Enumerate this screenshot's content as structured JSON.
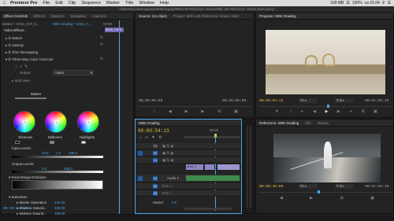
{
  "menubar": {
    "app": "Premiere Pro",
    "items": [
      "File",
      "Edit",
      "Clip",
      "Sequence",
      "Marker",
      "Title",
      "Window",
      "Help"
    ],
    "memory": "109 MB",
    "battery": "100%",
    "clock": "ca 15.04",
    "user": "Q"
  },
  "path": "~/Users/nicomsooyparus/Work/Aug.tip/M06.L05 Reference Viewer/M06 L05 Reference Viewer Start.prproj *",
  "effect_controls": {
    "tabs": [
      "Effect Controls",
      "Effects",
      "Markers",
      "Metadata",
      "Captions"
    ],
    "master_label": "Master * A016_C07_0...",
    "sequence_label": "M06 Grading * A016_C...",
    "ruler_time": "00:00",
    "clip_chip": "A016_C075",
    "section": "Video Effects",
    "effects": [
      "Motion",
      "Opacity",
      "Time Remapping",
      "Three-Way Color Corrector"
    ],
    "output_label": "Output",
    "output_value": "Video",
    "split_view": "Split View",
    "master_wheel": "Master",
    "wheels": [
      "Shadows",
      "Midtones",
      "Highlights"
    ],
    "input_levels_label": "Input Levels:",
    "input_levels": [
      "10.8",
      "1.0",
      "255.0"
    ],
    "output_levels_label": "Output Levels:",
    "output_levels": [
      "0.0",
      "255.0"
    ],
    "tonal_range": "Tonal Range Definition",
    "saturation": "Saturation",
    "saturation_rows": [
      {
        "label": "Master Saturation",
        "value": "134.00"
      },
      {
        "label": "Shadow Saturat...",
        "value": "100.00"
      },
      {
        "label": "Midtone Saturat...",
        "value": "100.00"
      }
    ],
    "footer_time": "00:00:54:13"
  },
  "source_panel": {
    "tabs": [
      "Source: (no clips)",
      "Project: M06 L05 Reference Viewer Start"
    ],
    "tc_left": "00;00;00;00",
    "tc_right": "00;00;00;00"
  },
  "program_panel": {
    "tabs": [
      "Program: M06 Grading"
    ],
    "tc_left": "00:00:54:13",
    "fit": "Fit",
    "quality": "Full",
    "tc_right": "00:01:55:10"
  },
  "reference_panel": {
    "tabs": [
      "Reference: M06 Grading",
      "Info",
      "History"
    ],
    "tc_left": "00:00:48:09",
    "fit": "Fit",
    "quality": "Full",
    "tc_right": "00:01:55:10"
  },
  "timeline": {
    "tabs": [
      "M06 Grading"
    ],
    "timecode": "00:00:54:13",
    "ruler_time": "00:00",
    "video_tracks": [
      "V3",
      "V2",
      "V1"
    ],
    "audio_tracks": [
      "A1",
      "A2",
      "A3"
    ],
    "audio_label": "Audio 1",
    "master_label": "Master",
    "master_value": "0.0",
    "clip_label": "A016_C"
  },
  "colors": {
    "accent_blue": "#4aa6e6",
    "timecode_yellow": "#e0c040",
    "clip_violet": "#8e86c4",
    "audio_green": "#3f8a4d",
    "track_blue": "#1f5aa8"
  }
}
